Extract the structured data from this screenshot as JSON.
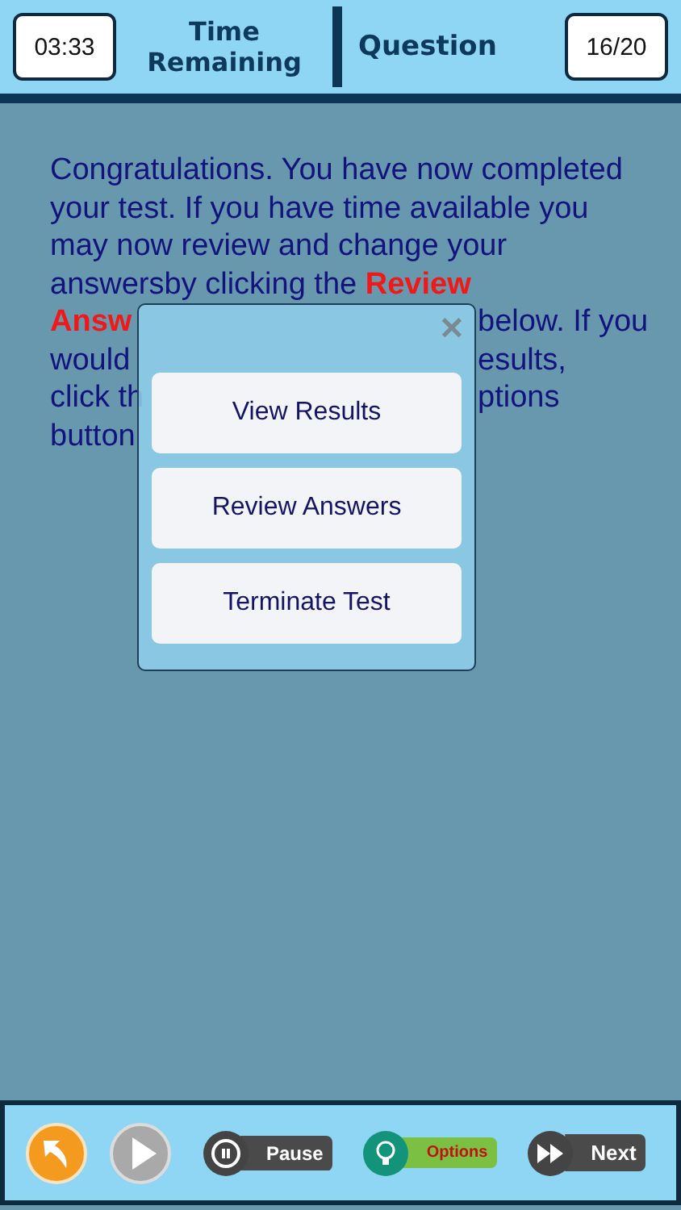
{
  "header": {
    "timer": "03:33",
    "title": "Time Remaining",
    "question_label": "Question",
    "question_count": "16/20"
  },
  "message": {
    "text": "Congratulations. You have now completed your test. If you have time available you may now review and change your answersby clicking the **Review**",
    "lines": [
      {
        "left": "Answ",
        "right": "below. If you",
        "highlight": true
      },
      {
        "left": "would",
        "right": "esults,",
        "highlight": false
      },
      {
        "left": "click th",
        "right": "ptions",
        "highlight": false
      },
      {
        "left": "button",
        "highlight": false
      }
    ]
  },
  "dialog": {
    "close": "✕",
    "buttons": [
      "View Results",
      "Review Answers",
      "Terminate Test"
    ]
  },
  "toolbar": [
    {
      "kind": "back"
    },
    {
      "kind": "play"
    },
    {
      "kind": "pause",
      "label": "Pause"
    },
    {
      "kind": "options",
      "label": "Options"
    },
    {
      "kind": "next",
      "label": "Next"
    }
  ]
}
